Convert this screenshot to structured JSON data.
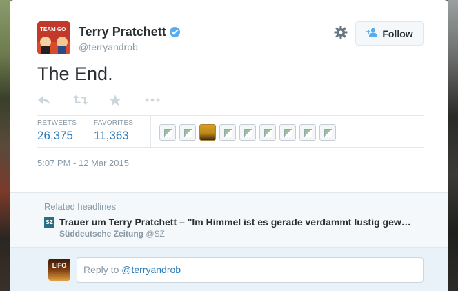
{
  "tweet": {
    "fullname": "Terry Pratchett",
    "handle": "@terryandrob",
    "avatar_text": "TEAM GO",
    "text": "The End.",
    "timestamp": "5:07 PM - 12 Mar 2015",
    "follow_label": "Follow",
    "actions": [
      "reply-icon",
      "retweet-icon",
      "favorite-icon",
      "more-icon"
    ],
    "stats": {
      "retweets_label": "RETWEETS",
      "retweets_value": "26,375",
      "favorites_label": "FAVORITES",
      "favorites_value": "11,363"
    },
    "favoriter_count": 9
  },
  "related": {
    "title": "Related headlines",
    "source_icon": "SZ",
    "headline": "Trauer um Terry Pratchett – \"Im Himmel ist es gerade verdammt lustig gew…",
    "source_name": "Süddeutsche Zeitung",
    "source_handle": "@SZ"
  },
  "reply": {
    "avatar_text": "LIFO",
    "prefix": "Reply to ",
    "mention": "@terryandrob"
  },
  "colors": {
    "link": "#2b7bb9",
    "verified": "#55acee",
    "muted": "#8899a6"
  }
}
